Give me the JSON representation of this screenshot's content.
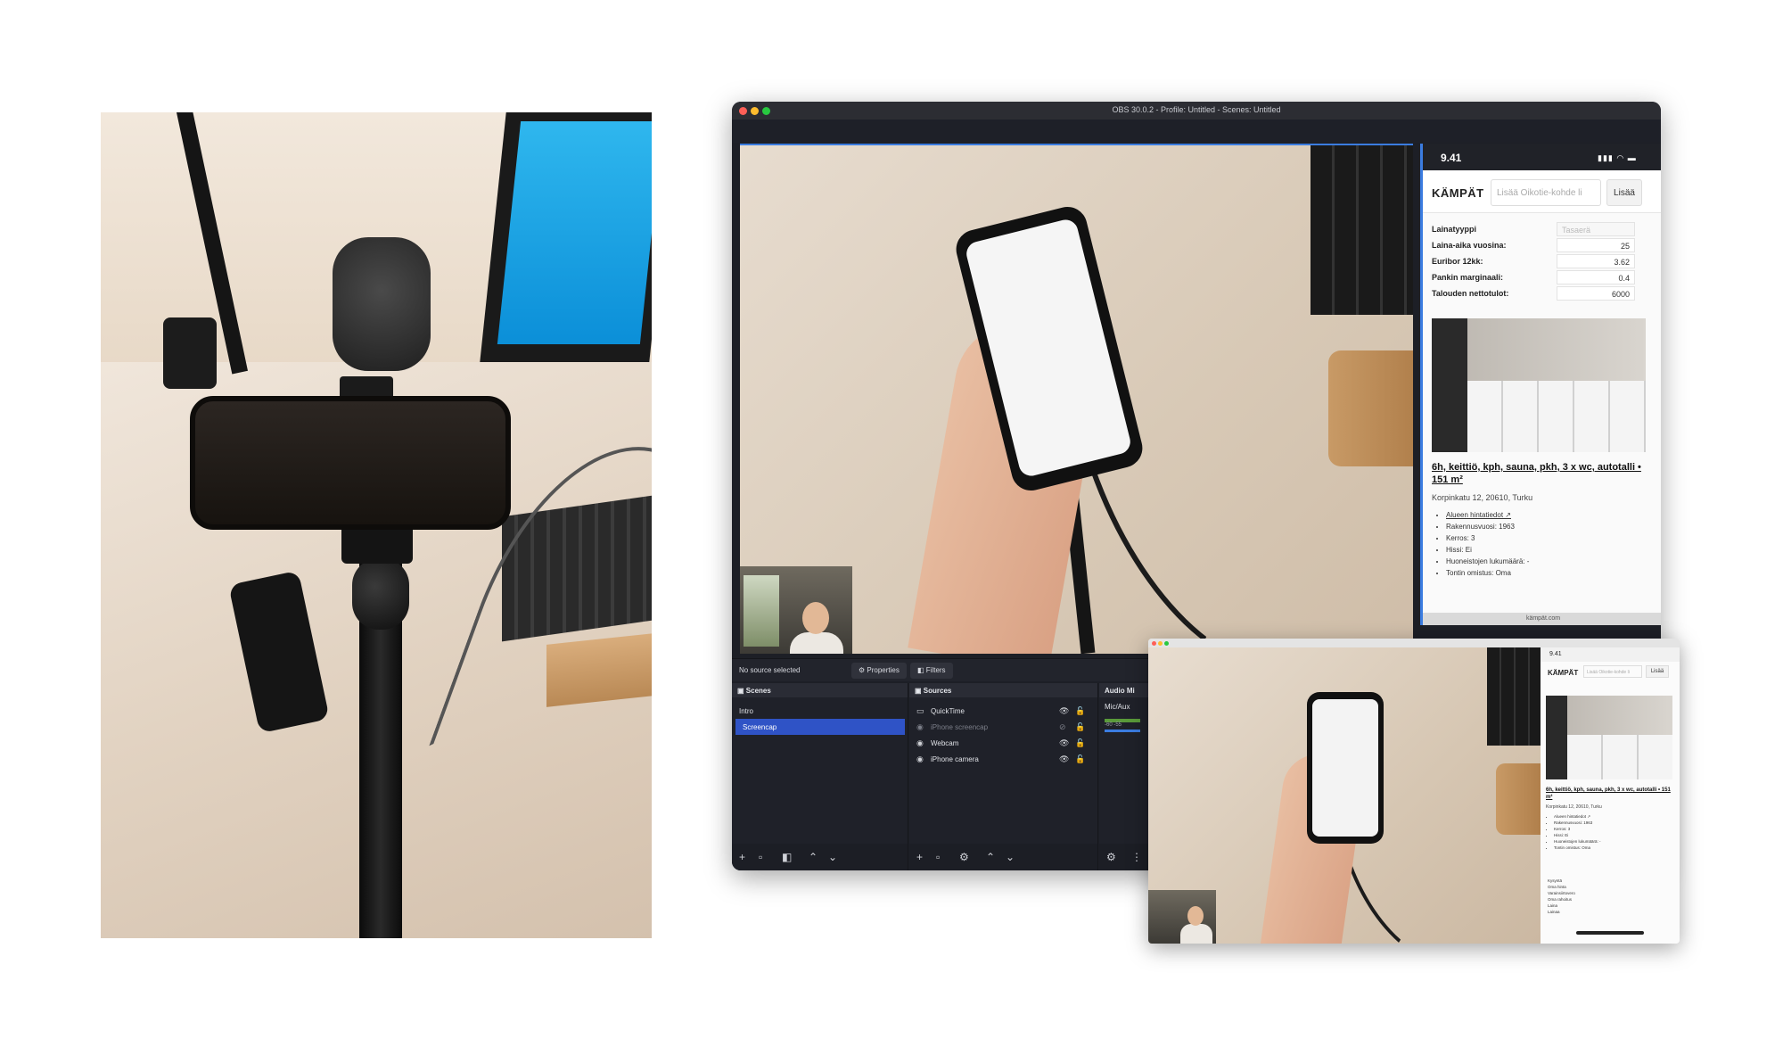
{
  "obs": {
    "window_title": "OBS 30.0.2 - Profile: Untitled - Scenes: Untitled",
    "status": "No source selected",
    "properties_label": "Properties",
    "filters_label": "Filters",
    "scenes": {
      "title": "Scenes",
      "items": [
        "Intro",
        "Screencap"
      ],
      "selected": "Screencap"
    },
    "sources": {
      "title": "Sources",
      "items": [
        "QuickTime",
        "iPhone screencap",
        "Webcam",
        "iPhone camera"
      ]
    },
    "audio": {
      "title": "Audio Mi",
      "channel": "Mic/Aux",
      "scale": "-60 -55"
    }
  },
  "iphone": {
    "time": "9.41",
    "brand": "KÄMPÄT",
    "search_placeholder": "Lisää Oikotie-kohde li",
    "add_label": "Lisää",
    "form": [
      {
        "label": "Lainatyyppi",
        "value": "Tasaerä"
      },
      {
        "label": "Laina-aika vuosina:",
        "value": "25"
      },
      {
        "label": "Euribor 12kk:",
        "value": "3.62"
      },
      {
        "label": "Pankin marginaali:",
        "value": "0.4"
      },
      {
        "label": "Talouden nettotulot:",
        "value": "6000"
      }
    ],
    "listing_title": "6h, keittiö, kph, sauna, pkh, 3 x wc, autotalli • 151 m²",
    "address": "Korpinkatu 12, 20610, Turku",
    "details": [
      "Alueen hintatiedot ↗",
      "Rakennusvuosi: 1963",
      "Kerros: 3",
      "Hissi: Ei",
      "Huoneistojen lukumäärä: -",
      "Tontin omistus: Oma"
    ],
    "footer": "kämpät.com"
  },
  "small_window": {
    "finance": [
      "Kysyntä",
      "Oma hinta",
      "Varainsiirtovero",
      "Oma rahoitus",
      "Laina",
      "Lainaa"
    ]
  },
  "colors": {
    "accent": "#3b7ce0",
    "selected_scene": "#2f53c6",
    "obs_bg": "#1d1f26"
  }
}
